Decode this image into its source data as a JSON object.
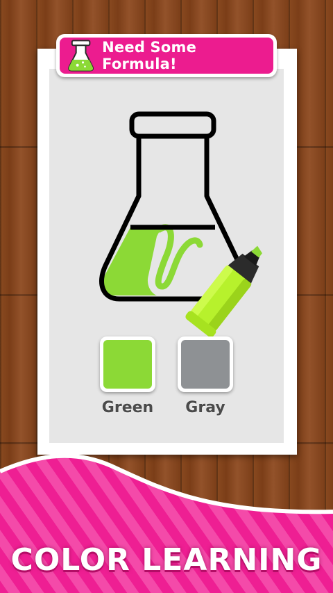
{
  "header": {
    "title": "Need Some Formula!",
    "icon": "flask-icon"
  },
  "flask": {
    "icon": "erlenmeyer-flask-icon",
    "fill_color": "#8cd936",
    "outline_color": "#000000"
  },
  "marker": {
    "icon": "highlighter-marker-icon",
    "color": "#b7f12c"
  },
  "swatches": [
    {
      "label": "Green",
      "color": "#8cd936"
    },
    {
      "label": "Gray",
      "color": "#8e9194"
    }
  ],
  "footer": {
    "title": "COLOR LEARNING"
  },
  "colors": {
    "accent": "#ec1c8f",
    "wood": "#7b3e18",
    "card": "#ffffff",
    "card_inner": "#e6e6e6"
  }
}
